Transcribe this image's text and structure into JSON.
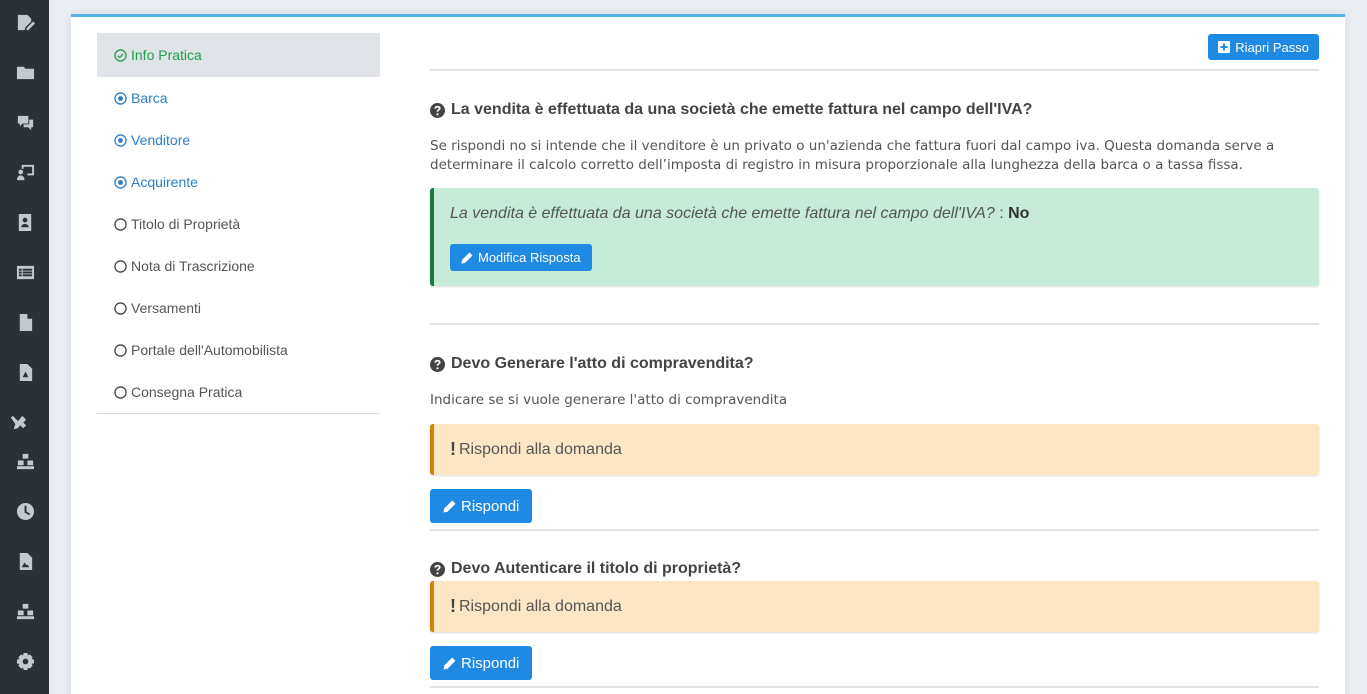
{
  "rail": {
    "icons": [
      "edit-document-icon",
      "folder-icon",
      "comments-icon",
      "chalkboard-user-icon",
      "address-book-icon",
      "list-alt-icon",
      "file-icon",
      "file-pdf-icon",
      "tools-icon",
      "cubes-icon",
      "clock-icon",
      "file-image-icon",
      "cubes-icon",
      "gear-icon"
    ]
  },
  "steps": [
    {
      "label": "Info Pratica",
      "state": "active"
    },
    {
      "label": "Barca",
      "state": "done"
    },
    {
      "label": "Venditore",
      "state": "done"
    },
    {
      "label": "Acquirente",
      "state": "done"
    },
    {
      "label": "Titolo di Proprietà",
      "state": "todo"
    },
    {
      "label": "Nota di Trascrizione",
      "state": "todo"
    },
    {
      "label": "Versamenti",
      "state": "todo"
    },
    {
      "label": "Portale dell'Automobilista",
      "state": "todo"
    },
    {
      "label": "Consegna Pratica",
      "state": "todo"
    }
  ],
  "toolbar": {
    "reopen_label": "Riapri Passo"
  },
  "questions": [
    {
      "title": "La vendita è effettuata da una società che emette fattura nel campo dell'IVA?",
      "description": "Se rispondi no si intende che il venditore è un privato o un'azienda che fattura fuori dal campo iva. Questa domanda serve a determinare il calcolo corretto dell’imposta di registro in misura proporzionale alla lunghezza della barca o a tassa fissa.",
      "answer_question": "La vendita è effettuata da una società che emette fattura nel campo dell'IVA?",
      "answer_sep": ":",
      "answer_value": "No",
      "edit_label": "Modifica Risposta"
    },
    {
      "title": "Devo Generare l'atto di compravendita?",
      "description": "Indicare se si vuole generare l'atto di compravendita",
      "warning": "Rispondi alla domanda",
      "answer_label": "Rispondi"
    },
    {
      "title": "Devo Autenticare il titolo di proprietà?",
      "warning": "Rispondi alla domanda",
      "answer_label": "Rispondi"
    }
  ],
  "colors": {
    "rail_bg": "#2b3137",
    "accent": "#1f8ae3",
    "success": "#22a04d",
    "success_box": "#c6ebd9",
    "warning_box": "#fde6c3"
  }
}
